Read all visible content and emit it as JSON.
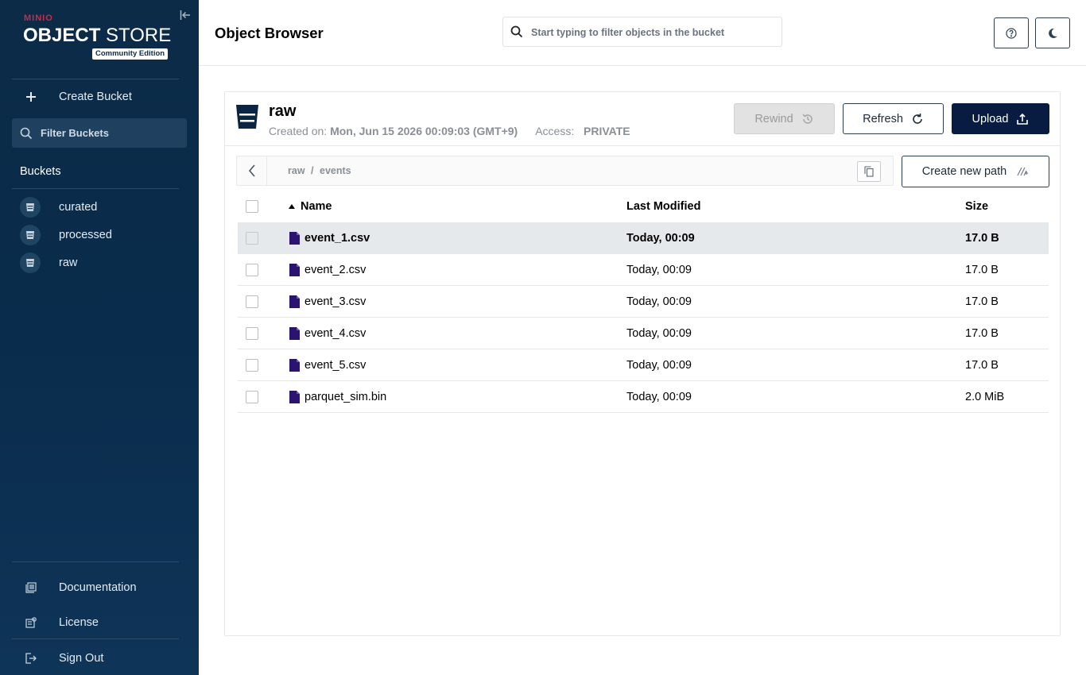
{
  "sidebar": {
    "logo_brand": "MINIO",
    "logo_title_bold": "OBJECT",
    "logo_title_rest": " STORE",
    "logo_edition": "Community Edition",
    "create_bucket": "Create Bucket",
    "filter_buckets": "Filter Buckets",
    "buckets_title": "Buckets",
    "buckets": [
      {
        "label": "curated"
      },
      {
        "label": "processed"
      },
      {
        "label": "raw"
      }
    ],
    "documentation": "Documentation",
    "license": "License",
    "sign_out": "Sign Out"
  },
  "header": {
    "title": "Object Browser",
    "search_placeholder": "Start typing to filter objects in the bucket"
  },
  "bucket": {
    "name": "raw",
    "created_label": "Created on:",
    "created_value": "Mon, Jun 15 2026 00:09:03 (GMT+9)",
    "access_label": "Access:",
    "access_value": "PRIVATE",
    "rewind_label": "Rewind",
    "refresh_label": "Refresh",
    "upload_label": "Upload"
  },
  "breadcrumb": {
    "root": "raw",
    "separator": "/",
    "folder": "events"
  },
  "create_path_label": "Create new path",
  "table": {
    "columns": {
      "name": "Name",
      "modified": "Last Modified",
      "size": "Size"
    },
    "sort_column": "Name",
    "rows": [
      {
        "name": "event_1.csv",
        "modified": "Today, 00:09",
        "size": "17.0 B",
        "selected": true
      },
      {
        "name": "event_2.csv",
        "modified": "Today, 00:09",
        "size": "17.0 B"
      },
      {
        "name": "event_3.csv",
        "modified": "Today, 00:09",
        "size": "17.0 B"
      },
      {
        "name": "event_4.csv",
        "modified": "Today, 00:09",
        "size": "17.0 B"
      },
      {
        "name": "event_5.csv",
        "modified": "Today, 00:09",
        "size": "17.0 B"
      },
      {
        "name": "parquet_sim.bin",
        "modified": "Today, 00:09",
        "size": "2.0 MiB"
      }
    ]
  },
  "colors": {
    "sidebar_bg": "#0b2b47",
    "brand_red": "#c72c48",
    "upload_bg": "#081c42",
    "file_icon": "#2a1470"
  }
}
